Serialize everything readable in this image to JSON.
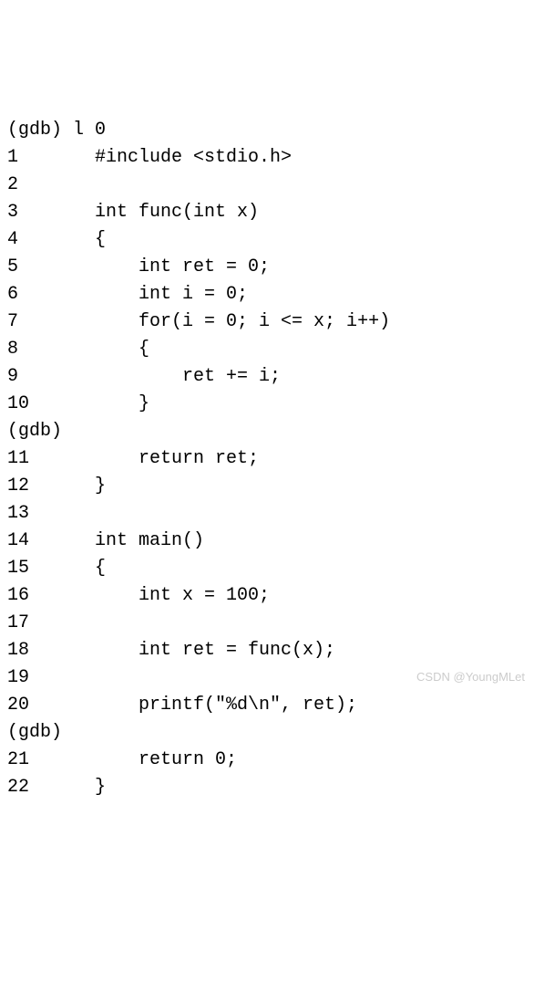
{
  "lines": [
    {
      "prompt": "(gdb) ",
      "command": "l 0"
    },
    {
      "lineno": "1",
      "code": "#include <stdio.h>"
    },
    {
      "lineno": "2",
      "code": ""
    },
    {
      "lineno": "3",
      "code": "int func(int x)"
    },
    {
      "lineno": "4",
      "code": "{"
    },
    {
      "lineno": "5",
      "code": "    int ret = 0;"
    },
    {
      "lineno": "6",
      "code": "    int i = 0;"
    },
    {
      "lineno": "7",
      "code": "    for(i = 0; i <= x; i++)"
    },
    {
      "lineno": "8",
      "code": "    {"
    },
    {
      "lineno": "9",
      "code": "        ret += i;"
    },
    {
      "lineno": "10",
      "code": "    }"
    },
    {
      "prompt": "(gdb) ",
      "command": ""
    },
    {
      "lineno": "11",
      "code": "    return ret;"
    },
    {
      "lineno": "12",
      "code": "}"
    },
    {
      "lineno": "13",
      "code": ""
    },
    {
      "lineno": "14",
      "code": "int main()"
    },
    {
      "lineno": "15",
      "code": "{"
    },
    {
      "lineno": "16",
      "code": "    int x = 100;"
    },
    {
      "lineno": "17",
      "code": ""
    },
    {
      "lineno": "18",
      "code": "    int ret = func(x);"
    },
    {
      "lineno": "19",
      "code": ""
    },
    {
      "lineno": "20",
      "code": "    printf(\"%d\\n\", ret);"
    },
    {
      "prompt": "(gdb) ",
      "command": ""
    },
    {
      "lineno": "21",
      "code": "    return 0;"
    },
    {
      "lineno": "22",
      "code": "}"
    }
  ],
  "watermark": "CSDN @YoungMLet"
}
